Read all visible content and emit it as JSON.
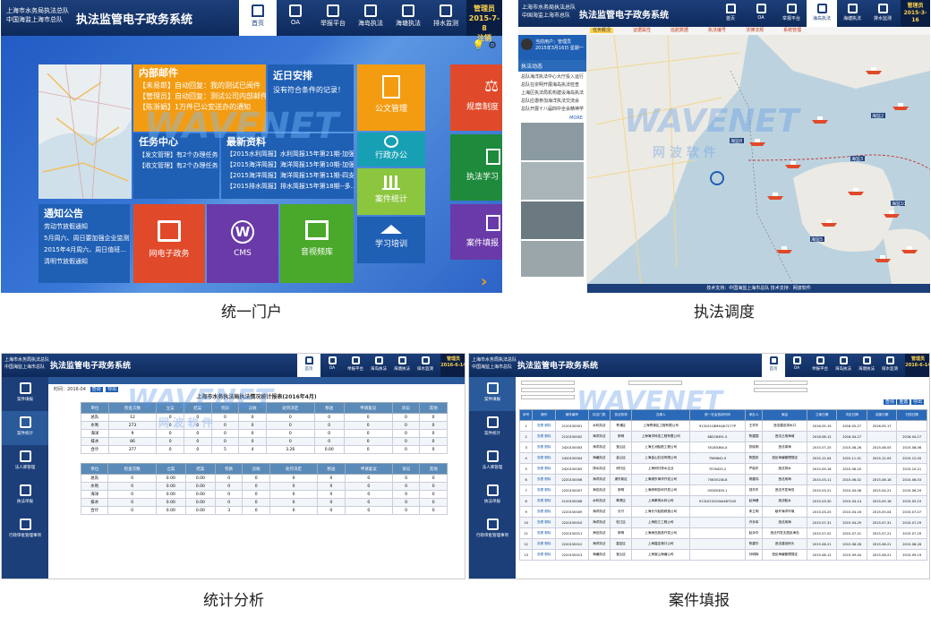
{
  "shared": {
    "org_line1": "上海市水务局执法总队",
    "org_line2": "中国海监上海市总队",
    "app_title": "执法监管电子政务系统",
    "user_label": "管理员",
    "nav": [
      "首页",
      "OA",
      "举报平台",
      "海岛执法",
      "海塘执法",
      "排水监测"
    ],
    "watermark_en": "WAVENET",
    "watermark_cn": "网 波 软 件"
  },
  "portal": {
    "date": "2015-7-8",
    "user_sub": "注销",
    "mail": {
      "title": "内部邮件",
      "items": [
        "【未易郎】自动回复：我的测试已阅件",
        "【管理员】自动回复：测试公司内部邮件",
        "【陈浙娟】1万件已公安送办的通知"
      ]
    },
    "schedule": {
      "title": "近日安排",
      "text": "没有符合条件的记录！"
    },
    "task": {
      "title": "任务中心",
      "items": [
        "【发文管理】有2个办理任务",
        "【收文管理】有2个办理任务"
      ]
    },
    "news": {
      "title": "最新资料",
      "items": [
        "【2015水利简报】水利简报15年第21期-加强...",
        "【2015海洋简报】海洋简报15年第10期-加强...",
        "【2015海洋简报】海洋简报15年第11期-四支...",
        "【2015排水简报】排水简报15年第18期--多..."
      ]
    },
    "notice": {
      "title": "通知公告",
      "items": [
        "劳动节放假通知",
        "5月周六、周日要加强企业监测排...",
        "2015年4月周六、周日值班...",
        "清明节放假通知"
      ]
    },
    "tiles": {
      "doc_mgmt": "公文管理",
      "admin_office": "行政办公",
      "case_stats": "案件统计",
      "study": "学习培训",
      "gov": "网电子政务",
      "cms": "CMS",
      "video": "音视频库",
      "regs": "规章制度",
      "exec_study": "执法学习",
      "case_fill": "案件填报"
    }
  },
  "dispatch": {
    "date": "2015-3-16",
    "user_name": "当前用户：管理员",
    "login_date": "2015年3月16日 星期一",
    "tabs": [
      "任务概况",
      "证据属性",
      "巡航数据",
      "执法编号",
      "法律法规",
      "系统管理"
    ],
    "section": "执法动态",
    "news": [
      "总队海洋执法中心大厅投入运行",
      "总队在崇明开展海岛执法检查",
      "上海区执法局机构建设海岛执法",
      "总队应邀参加海洋执法交流会",
      "总队开展十八届四中全会精神学习"
    ],
    "more": "MORE",
    "ship_tags": [
      "海监2",
      "海监3",
      "海监5",
      "海监8",
      "海监10"
    ],
    "footer": "技术支持：中国海监上海市总队       技术支持：网波软件"
  },
  "stats": {
    "date": "2016-6-14",
    "table_title": "上海市水务执法局执法情况统计报表(2016年4月)",
    "query_label": "时间：2016-04",
    "query_btn": "查询",
    "export_btn": "导出",
    "sidebar": [
      "案件填报",
      "案件统计",
      "法人库管理",
      "执法单报",
      "行政审批管理事项"
    ],
    "col_headers": [
      "单位",
      "检查次数",
      "立案",
      "结案",
      "罚款",
      "没收",
      "处罚决定",
      "移送",
      "申请复议",
      "诉讼",
      "其他"
    ],
    "rows": [
      [
        "总队",
        "12",
        "0",
        "0",
        "0",
        "0",
        "0",
        "0",
        "0",
        "0",
        "0"
      ],
      [
        "水利",
        "273",
        "0",
        "0",
        "0",
        "0",
        "0",
        "0",
        "0",
        "0",
        "0"
      ],
      [
        "海洋",
        "9",
        "0",
        "0",
        "0",
        "0",
        "0",
        "0",
        "0",
        "0",
        "0"
      ],
      [
        "排水",
        "86",
        "0",
        "0",
        "0",
        "0",
        "0",
        "0",
        "0",
        "0",
        "0"
      ],
      [
        "合计",
        "377",
        "0",
        "0",
        "5",
        "4",
        "3.26",
        "0.00",
        "0",
        "0",
        "0"
      ]
    ],
    "rows2": [
      [
        "总队",
        "0",
        "0.00",
        "0.00",
        "0",
        "0",
        "0",
        "0",
        "0",
        "0",
        "0"
      ],
      [
        "水利",
        "0",
        "0.00",
        "0.00",
        "0",
        "0",
        "0",
        "0",
        "0",
        "0",
        "0"
      ],
      [
        "海洋",
        "0",
        "0.00",
        "0.00",
        "0",
        "0",
        "0",
        "0",
        "0",
        "0",
        "0"
      ],
      [
        "排水",
        "0",
        "0.00",
        "0.00",
        "0",
        "0",
        "0",
        "0",
        "0",
        "0",
        "0"
      ],
      [
        "合计",
        "0",
        "0.00",
        "0.00",
        "3",
        "0",
        "0",
        "0",
        "0",
        "0",
        "0"
      ]
    ]
  },
  "cases": {
    "date": "2016-6-14",
    "col_headers": [
      "序号",
      "操作",
      "案件编号",
      "执法门类",
      "执法机构",
      "当事人",
      "统一社会信用代码",
      "承办人",
      "案由",
      "立案日期",
      "决定日期",
      "结案日期",
      "归档日期"
    ],
    "rows": [
      [
        "1",
        "查看 删除",
        "2120150001",
        "水利执法",
        "青浦区",
        "上海青浦区工程有限公司",
        "91310118MA1JK7C77P",
        "王学东",
        "违法建设排水口",
        "2016-05-19",
        "2016-05-27",
        "2016-05-17",
        ""
      ],
      [
        "2",
        "查看 删除",
        "2120150002",
        "海洋执法",
        "崇明",
        "上海海洋科技工程有限公司",
        "68226391-5",
        "陈建国",
        "违法占用海域",
        "2016-08-12",
        "2016-04-27",
        "",
        "2016-04-27"
      ],
      [
        "3",
        "查看 删除",
        "2420150003",
        "海洋执法",
        "宝山区",
        "上海五洲船舶工程公司",
        "55183364-X",
        "张晓明",
        "违法填海",
        "2015-07-25",
        "2015-08-26",
        "2015-08-05",
        "2015-08-06"
      ],
      [
        "4",
        "查看 删除",
        "2420150004",
        "海塘执法",
        "金山区",
        "上海金山石化有限公司",
        "7569842-9",
        "陈国庆",
        "违反海塘管理规定",
        "2015-12-04",
        "2015-11-01",
        "2015-12-05",
        "2015-12-05"
      ],
      [
        "5",
        "查看 删除",
        "2420150005",
        "排水执法",
        "闵行区",
        "上海闵行排水企业",
        "7576425-2",
        "严晓东",
        "违法排水",
        "2015-09-16",
        "2015-06-20",
        "",
        "2015-10-21"
      ],
      [
        "6",
        "查看 删除",
        "2220150006",
        "海洋执法",
        "浦东新区",
        "上海浦东海洋开发公司",
        "75635138-8",
        "杨建伟",
        "违法用海",
        "2015-03-11",
        "2015-06-02",
        "2015-06-18",
        "2015-06-03"
      ],
      [
        "7",
        "查看 删除",
        "2220150007",
        "海岛执法",
        "崇明",
        "上海崇明岛屿开发公司",
        "05265309-1",
        "钱华东",
        "违法开发海岛",
        "2015-03-21",
        "2015-04-06",
        "2015-04-21",
        "2015-06-29"
      ],
      [
        "8",
        "查看 删除",
        "2120150008",
        "水利执法",
        "奉贤区",
        "上海奉贤水利公司",
        "913102310344487200",
        "赵海峰",
        "违法取水",
        "2015-03-30",
        "2015-04-14",
        "2015-05-18",
        "2015-05-19"
      ],
      [
        "9",
        "查看 删除",
        "2220150009",
        "海洋执法",
        "长兴",
        "上海长兴船舶修造公司",
        "",
        "朱立明",
        "破坏海洋环境",
        "2015-03-25",
        "2015-04-16",
        "2015-05-04",
        "2015-07-07"
      ],
      [
        "10",
        "查看 删除",
        "2220150010",
        "海洋执法",
        "松江区",
        "上海松江工程公司",
        "",
        "许永军",
        "违法用海",
        "2015-07-31",
        "2015-04-29",
        "2015-07-31",
        "2015-07-29"
      ],
      [
        "11",
        "查看 删除",
        "2220150011",
        "海岛执法",
        "崇明",
        "上海海岛旅游开发公司",
        "",
        "赵永华",
        "违法开发无居民海岛",
        "2015-07-02",
        "2015-07-21",
        "2015-07-21",
        "2015-07-29"
      ],
      [
        "12",
        "查看 删除",
        "2220150012",
        "海洋执法",
        "嘉定区",
        "上海嘉定港口公司",
        "",
        "陈建华",
        "违法建设码头",
        "2015-08-21",
        "2015-08-28",
        "2015-08-21",
        "2015-08-26"
      ],
      [
        "13",
        "查看 删除",
        "2220150013",
        "海塘执法",
        "宝山区",
        "上海宝山海塘公司",
        "",
        "孙明辉",
        "违反海塘管理规定",
        "2015-08-12",
        "2015-09-04",
        "2015-08-21",
        "2015-09-19"
      ]
    ],
    "buttons": [
      "查询",
      "重置",
      "导出"
    ]
  },
  "captions": {
    "portal": "统一门户",
    "dispatch": "执法调度",
    "stats": "统计分析",
    "cases": "案件填报"
  },
  "colors": {
    "header": "#1c3f7a",
    "orange": "#f39c12",
    "blue": "#1f5fb4",
    "teal": "#17a0b4",
    "green": "#4aa82a",
    "purple": "#6a3aa8",
    "red": "#e04a2a",
    "lime": "#8cc63f",
    "darkgreen": "#1e8a3c"
  }
}
